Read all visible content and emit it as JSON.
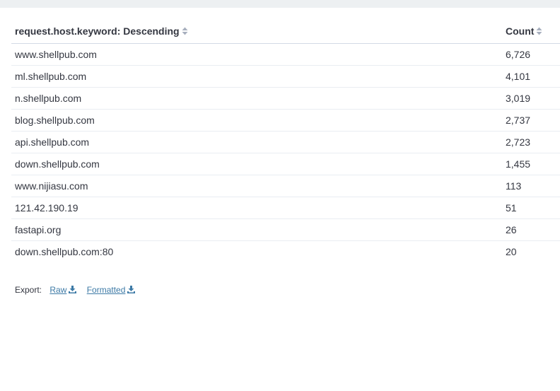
{
  "table": {
    "columns": [
      {
        "label": "request.host.keyword: Descending"
      },
      {
        "label": "Count"
      }
    ],
    "rows": [
      {
        "host": "www.shellpub.com",
        "count": "6,726"
      },
      {
        "host": "ml.shellpub.com",
        "count": "4,101"
      },
      {
        "host": "n.shellpub.com",
        "count": "3,019"
      },
      {
        "host": "blog.shellpub.com",
        "count": "2,737"
      },
      {
        "host": "api.shellpub.com",
        "count": "2,723"
      },
      {
        "host": "down.shellpub.com",
        "count": "1,455"
      },
      {
        "host": "www.nijiasu.com",
        "count": "113"
      },
      {
        "host": "121.42.190.19",
        "count": "51"
      },
      {
        "host": "fastapi.org",
        "count": "26"
      },
      {
        "host": "down.shellpub.com:80",
        "count": "20"
      }
    ]
  },
  "export": {
    "label": "Export:",
    "raw_label": "Raw",
    "formatted_label": "Formatted"
  },
  "icons": {
    "sort": "sort-icon",
    "download": "download-icon"
  },
  "colors": {
    "link": "#3d7aa6",
    "header_text": "#343741",
    "top_bar": "#edf0f2"
  }
}
